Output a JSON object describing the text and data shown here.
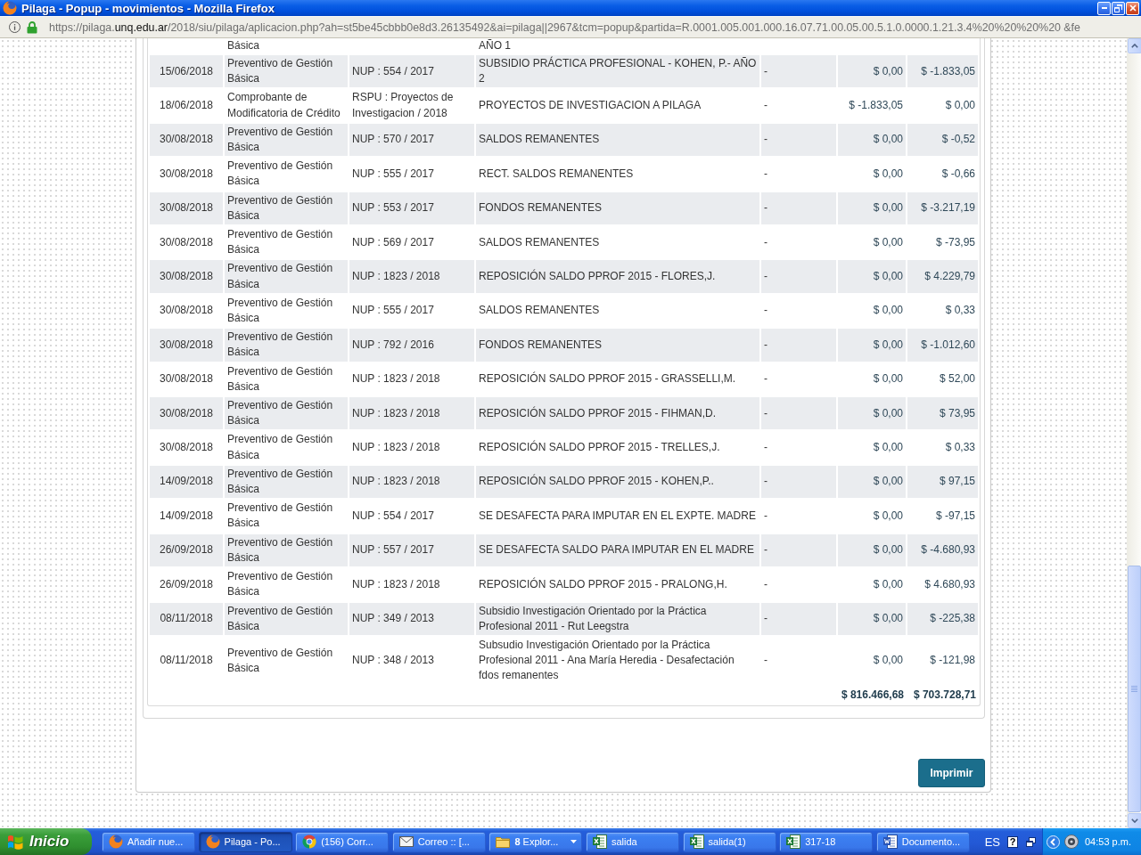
{
  "window": {
    "title": "Pilaga - Popup - movimientos - Mozilla Firefox"
  },
  "address_bar": {
    "url_start": "https://pilaga.",
    "url_domain": "unq.edu.ar",
    "url_end": "/2018/siu/pilaga/aplicacion.php?ah=st5be45cbbb0e8d3.26135492&ai=pilaga||2967&tcm=popup&partida=R.0001.005.001.000.16.07.71.00.05.00.5.1.0.0000.1.21.3.4%20%20%20%20 &fe"
  },
  "table": {
    "partial_top_row": {
      "column_2": "Básica",
      "column_4": "AÑO 1"
    },
    "rows": [
      {
        "column_1": "15/06/2018",
        "column_2": "Preventivo de Gestión Básica",
        "column_3": "NUP : 554 / 2017",
        "column_4": "SUBSIDIO PRÁCTICA PROFESIONAL - KOHEN, P.- AÑO 2",
        "column_5": "-",
        "column_6": "$ 0,00",
        "column_7": "$ -1.833,05"
      },
      {
        "column_1": "18/06/2018",
        "column_2": "Comprobante de Modificatoria de Crédito",
        "column_3": "RSPU : Proyectos de Investigacion / 2018",
        "column_4": "PROYECTOS DE INVESTIGACION A PILAGA",
        "column_5": "-",
        "column_6": "$ -1.833,05",
        "column_7": "$ 0,00"
      },
      {
        "column_1": "30/08/2018",
        "column_2": "Preventivo de Gestión Básica",
        "column_3": "NUP : 570 / 2017",
        "column_4": "SALDOS REMANENTES",
        "column_5": "-",
        "column_6": "$ 0,00",
        "column_7": "$ -0,52"
      },
      {
        "column_1": "30/08/2018",
        "column_2": "Preventivo de Gestión Básica",
        "column_3": "NUP : 555 / 2017",
        "column_4": "RECT. SALDOS REMANENTES",
        "column_5": "-",
        "column_6": "$ 0,00",
        "column_7": "$ -0,66"
      },
      {
        "column_1": "30/08/2018",
        "column_2": "Preventivo de Gestión Básica",
        "column_3": "NUP : 553 / 2017",
        "column_4": "FONDOS REMANENTES",
        "column_5": "-",
        "column_6": "$ 0,00",
        "column_7": "$ -3.217,19"
      },
      {
        "column_1": "30/08/2018",
        "column_2": "Preventivo de Gestión Básica",
        "column_3": "NUP : 569 / 2017",
        "column_4": "SALDOS REMANENTES",
        "column_5": "-",
        "column_6": "$ 0,00",
        "column_7": "$ -73,95"
      },
      {
        "column_1": "30/08/2018",
        "column_2": "Preventivo de Gestión Básica",
        "column_3": "NUP : 1823 / 2018",
        "column_4": "REPOSICIÓN SALDO PPROF 2015 - FLORES,J.",
        "column_5": "-",
        "column_6": "$ 0,00",
        "column_7": "$ 4.229,79"
      },
      {
        "column_1": "30/08/2018",
        "column_2": "Preventivo de Gestión Básica",
        "column_3": "NUP : 555 / 2017",
        "column_4": "SALDOS REMANENTES",
        "column_5": "-",
        "column_6": "$ 0,00",
        "column_7": "$ 0,33"
      },
      {
        "column_1": "30/08/2018",
        "column_2": "Preventivo de Gestión Básica",
        "column_3": "NUP : 792 / 2016",
        "column_4": "FONDOS REMANENTES",
        "column_5": "-",
        "column_6": "$ 0,00",
        "column_7": "$ -1.012,60"
      },
      {
        "column_1": "30/08/2018",
        "column_2": "Preventivo de Gestión Básica",
        "column_3": "NUP : 1823 / 2018",
        "column_4": "REPOSICIÓN SALDO PPROF 2015 - GRASSELLI,M.",
        "column_5": "-",
        "column_6": "$ 0,00",
        "column_7": "$ 52,00"
      },
      {
        "column_1": "30/08/2018",
        "column_2": "Preventivo de Gestión Básica",
        "column_3": "NUP : 1823 / 2018",
        "column_4": "REPOSICIÓN SALDO PPROF 2015 - FIHMAN,D.",
        "column_5": "-",
        "column_6": "$ 0,00",
        "column_7": "$ 73,95"
      },
      {
        "column_1": "30/08/2018",
        "column_2": "Preventivo de Gestión Básica",
        "column_3": "NUP : 1823 / 2018",
        "column_4": "REPOSICIÓN SALDO PPROF 2015 - TRELLES,J.",
        "column_5": "-",
        "column_6": "$ 0,00",
        "column_7": "$ 0,33"
      },
      {
        "column_1": "14/09/2018",
        "column_2": "Preventivo de Gestión Básica",
        "column_3": "NUP : 1823 / 2018",
        "column_4": "REPOSICIÓN SALDO PPROF 2015 - KOHEN,P..",
        "column_5": "-",
        "column_6": "$ 0,00",
        "column_7": "$ 97,15"
      },
      {
        "column_1": "14/09/2018",
        "column_2": "Preventivo de Gestión Básica",
        "column_3": "NUP : 554 / 2017",
        "column_4": "SE DESAFECTA PARA IMPUTAR EN EL EXPTE. MADRE",
        "column_5": "-",
        "column_6": "$ 0,00",
        "column_7": "$ -97,15"
      },
      {
        "column_1": "26/09/2018",
        "column_2": "Preventivo de Gestión Básica",
        "column_3": "NUP : 557 / 2017",
        "column_4": "SE DESAFECTA SALDO PARA IMPUTAR EN EL MADRE",
        "column_5": "-",
        "column_6": "$ 0,00",
        "column_7": "$ -4.680,93"
      },
      {
        "column_1": "26/09/2018",
        "column_2": "Preventivo de Gestión Básica",
        "column_3": "NUP : 1823 / 2018",
        "column_4": "REPOSICIÓN SALDO PPROF 2015 - PRALONG,H.",
        "column_5": "-",
        "column_6": "$ 0,00",
        "column_7": "$ 4.680,93"
      },
      {
        "column_1": "08/11/2018",
        "column_2": "Preventivo de Gestión Básica",
        "column_3": "NUP : 349 / 2013",
        "column_4": "Subsidio Investigación Orientado por la Práctica Profesional 2011 - Rut Leegstra",
        "column_5": "-",
        "column_6": "$ 0,00",
        "column_7": "$ -225,38"
      },
      {
        "column_1": "08/11/2018",
        "column_2": "Preventivo de Gestión Básica",
        "column_3": "NUP : 348 / 2013",
        "column_4": "Subsudio Investigación Orientado por la Práctica Profesional 2011 - Ana María Heredia - Desafectación fdos remanentes",
        "column_5": "-",
        "column_6": "$ 0,00",
        "column_7": "$ -121,98"
      }
    ],
    "totals": {
      "column_6": "$ 816.466,68",
      "column_7": "$ 703.728,71"
    }
  },
  "print_button": {
    "label": "Imprimir"
  },
  "taskbar": {
    "start_button": "Inicio",
    "tasks": [
      {
        "label": "Añadir nue...",
        "kind": "globe",
        "selected": false,
        "grouped": false
      },
      {
        "label": "Pilaga - Po...",
        "kind": "globe",
        "selected": true,
        "grouped": false
      },
      {
        "label": "(156) Corr...",
        "kind": "pinwheel",
        "selected": false,
        "grouped": false
      },
      {
        "label": "Correo :: [...",
        "kind": "envelope",
        "selected": false,
        "grouped": false
      },
      {
        "label": "**8** Explor...",
        "kind": "folder",
        "selected": false,
        "grouped": true
      },
      {
        "label": "salida",
        "kind": "spreadsheet",
        "selected": false,
        "grouped": false
      },
      {
        "label": "salida(1)",
        "kind": "spreadsheet",
        "selected": false,
        "grouped": false
      },
      {
        "label": "317-18",
        "kind": "spreadsheet",
        "selected": false,
        "grouped": false
      },
      {
        "label": "Documento...",
        "kind": "document",
        "selected": false,
        "grouped": false
      }
    ],
    "language": "ES",
    "help": "?",
    "clock": "04:53 p.m."
  }
}
